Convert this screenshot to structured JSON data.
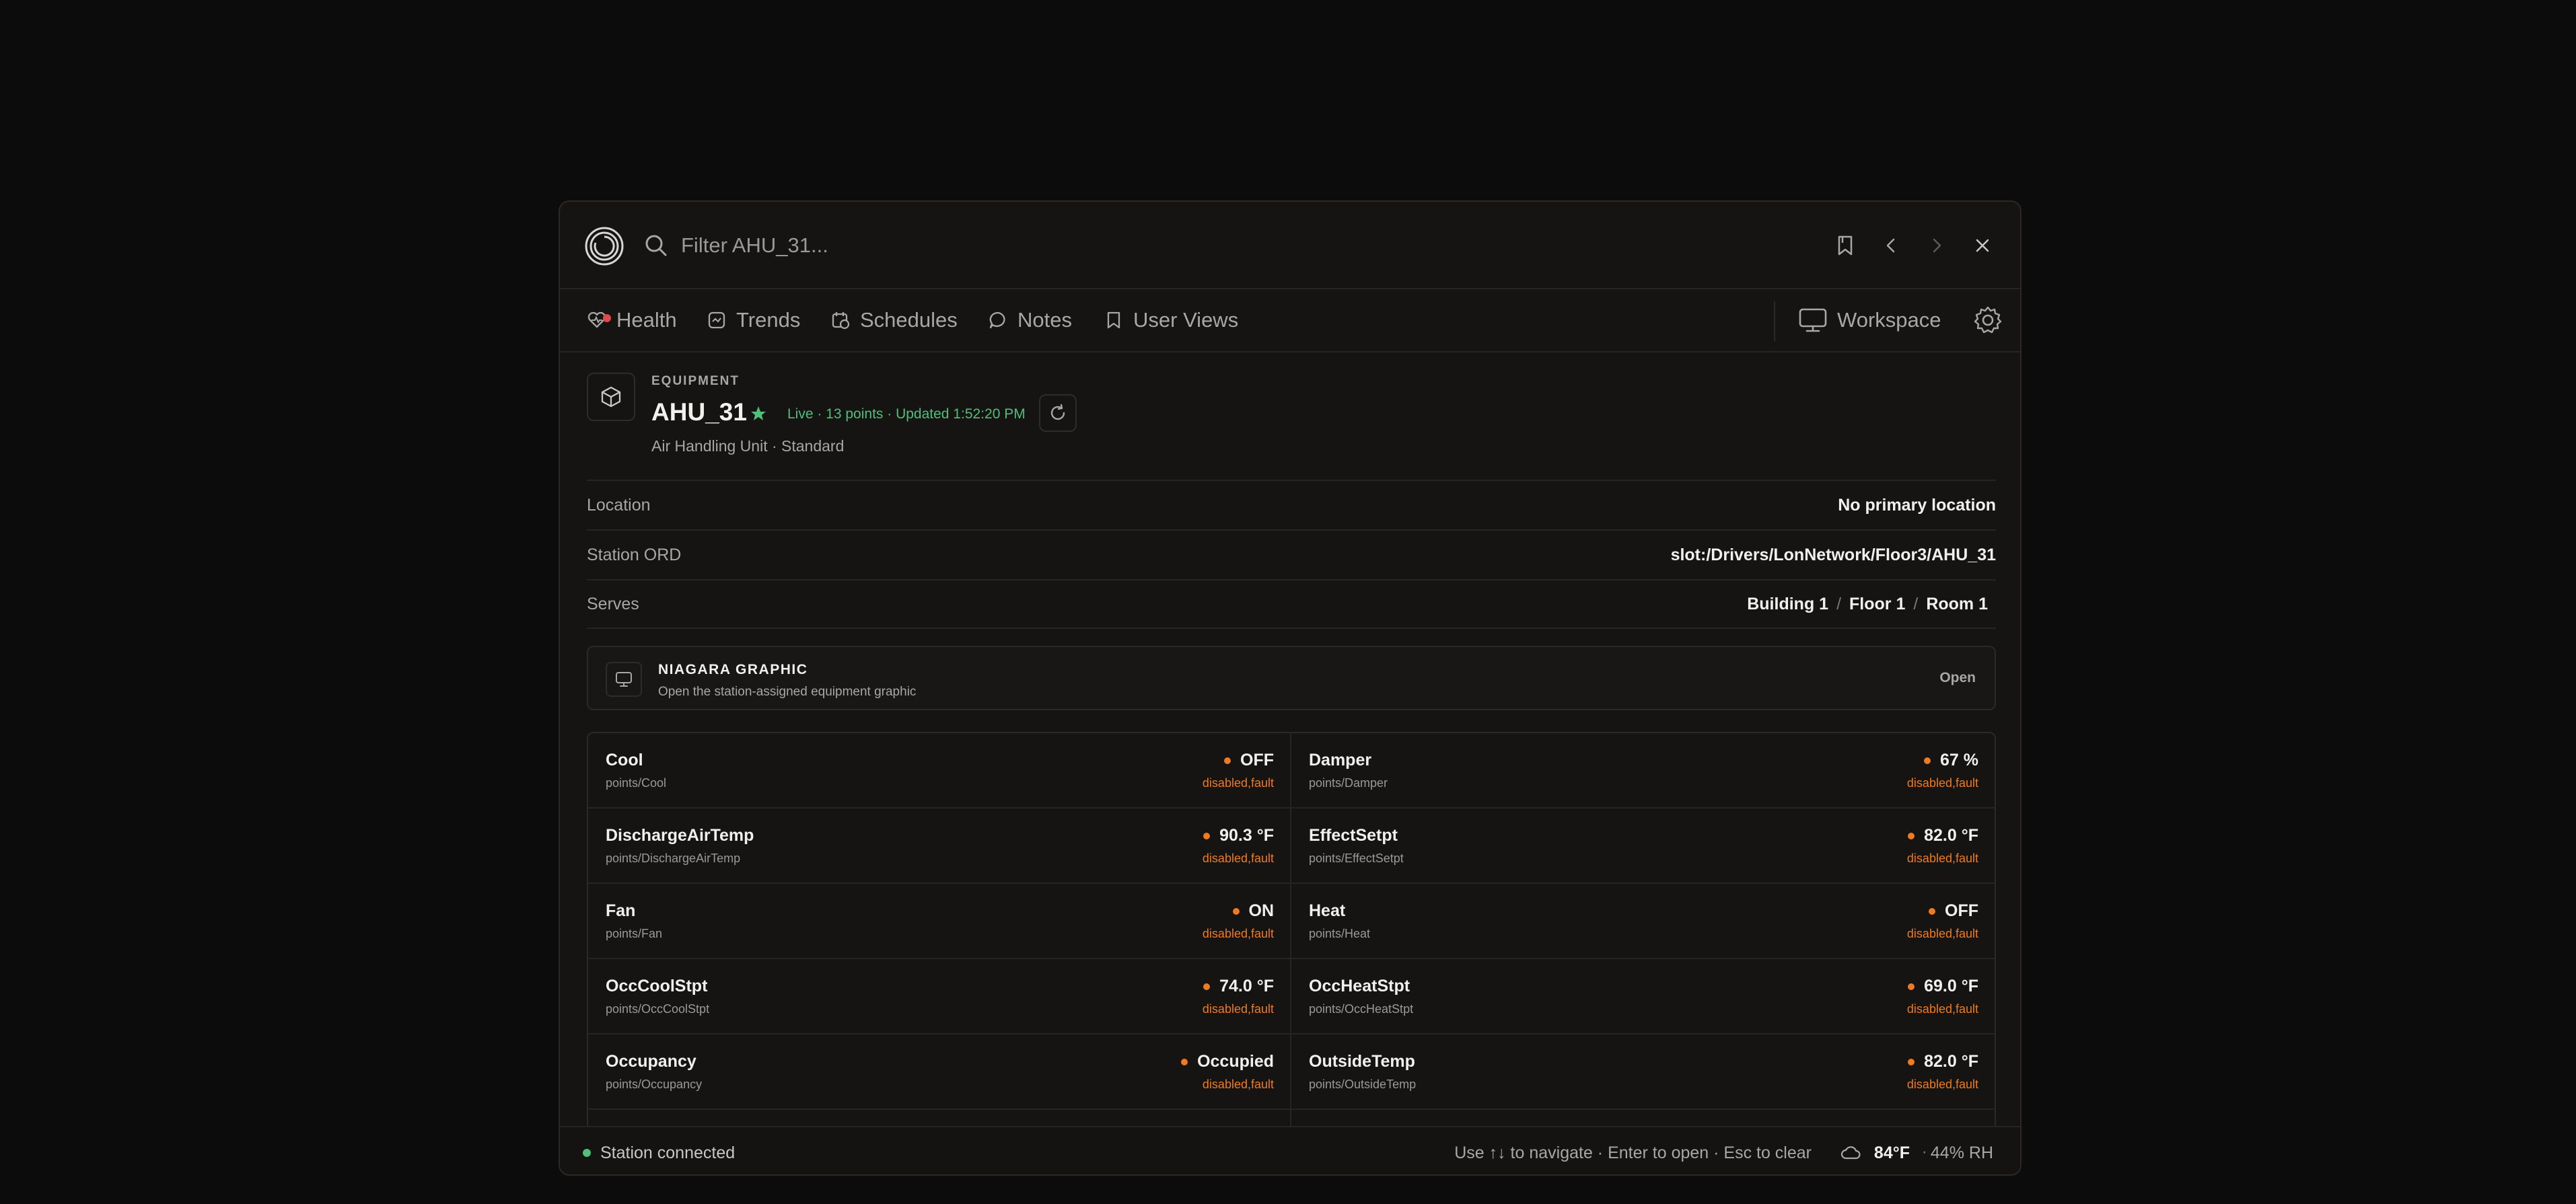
{
  "search": {
    "placeholder": "Filter AHU_31..."
  },
  "nav": {
    "tabs": [
      {
        "label": "Health"
      },
      {
        "label": "Trends"
      },
      {
        "label": "Schedules"
      },
      {
        "label": "Notes"
      },
      {
        "label": "User Views"
      }
    ],
    "workspace_label": "Workspace"
  },
  "equipment": {
    "kicker": "EQUIPMENT",
    "name": "AHU_31",
    "status": "Live · 13 points · Updated 1:52:20 PM",
    "subtitle": "Air Handling Unit · Standard"
  },
  "properties": {
    "location": {
      "label": "Location",
      "value": "No primary location"
    },
    "station_ord": {
      "label": "Station ORD",
      "value": "slot:/Drivers/LonNetwork/Floor3/AHU_31"
    },
    "serves": {
      "label": "Serves",
      "path": [
        "Building 1",
        "Floor 1",
        "Room 1"
      ],
      "separator": "/"
    }
  },
  "graphic": {
    "title": "NIAGARA GRAPHIC",
    "description": "Open the station-assigned equipment graphic",
    "action": "Open"
  },
  "points": [
    {
      "name": "Cool",
      "path": "points/Cool",
      "value": "OFF",
      "status": "disabled,fault"
    },
    {
      "name": "Damper",
      "path": "points/Damper",
      "value": "67 %",
      "status": "disabled,fault"
    },
    {
      "name": "DischargeAirTemp",
      "path": "points/DischargeAirTemp",
      "value": "90.3 °F",
      "status": "disabled,fault"
    },
    {
      "name": "EffectSetpt",
      "path": "points/EffectSetpt",
      "value": "82.0 °F",
      "status": "disabled,fault"
    },
    {
      "name": "Fan",
      "path": "points/Fan",
      "value": "ON",
      "status": "disabled,fault"
    },
    {
      "name": "Heat",
      "path": "points/Heat",
      "value": "OFF",
      "status": "disabled,fault"
    },
    {
      "name": "OccCoolStpt",
      "path": "points/OccCoolStpt",
      "value": "74.0 °F",
      "status": "disabled,fault"
    },
    {
      "name": "OccHeatStpt",
      "path": "points/OccHeatStpt",
      "value": "69.0 °F",
      "status": "disabled,fault"
    },
    {
      "name": "Occupancy",
      "path": "points/Occupancy",
      "value": "Occupied",
      "status": "disabled,fault"
    },
    {
      "name": "OutsideTemp",
      "path": "points/OutsideTemp",
      "value": "82.0 °F",
      "status": "disabled,fault"
    }
  ],
  "footer": {
    "connection": "Station connected",
    "hint": "Use ↑↓ to navigate · Enter to open · Esc to clear",
    "temperature": "84°F",
    "separator": "·",
    "humidity": "44% RH"
  },
  "colors": {
    "accent_green": "#4fbf7a",
    "fault_orange": "#f07a1f",
    "alert_red": "#e0484a"
  },
  "icons": [
    "app-logo-icon",
    "search-icon",
    "bookmark-icon",
    "chevron-left-icon",
    "chevron-right-icon",
    "close-icon",
    "heart-pulse-icon",
    "chart-icon",
    "calendar-clock-icon",
    "chat-bubble-icon",
    "bookmark-icon",
    "monitor-icon",
    "gear-icon",
    "cube-icon",
    "star-icon",
    "refresh-icon",
    "monitor-icon",
    "cloud-icon"
  ]
}
